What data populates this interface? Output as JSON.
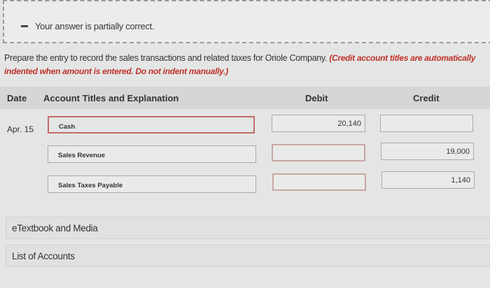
{
  "feedback": {
    "message": "Your answer is partially correct."
  },
  "instructions": {
    "text": "Prepare the entry to record the sales transactions and related taxes for Oriole Company.",
    "note": "(Credit account titles are automatically indented when amount is entered. Do not indent manually.)"
  },
  "table": {
    "headers": {
      "date": "Date",
      "account": "Account Titles and Explanation",
      "debit": "Debit",
      "credit": "Credit"
    },
    "rows": [
      {
        "date": "Apr. 15",
        "account": "Cash",
        "debit": "20,140",
        "credit": ""
      },
      {
        "date": "",
        "account": "Sales Revenue",
        "debit": "",
        "credit": "19,000"
      },
      {
        "date": "",
        "account": "Sales Taxes Payable",
        "debit": "",
        "credit": "1,140"
      }
    ]
  },
  "links": {
    "etextbook": "eTextbook and Media",
    "accounts": "List of Accounts"
  }
}
